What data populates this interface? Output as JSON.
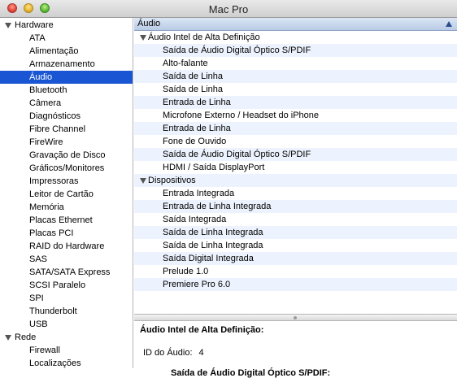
{
  "window": {
    "title": "Mac Pro"
  },
  "sidebar": {
    "rows": [
      {
        "type": "group",
        "label": "Hardware"
      },
      {
        "type": "item",
        "label": "ATA"
      },
      {
        "type": "item",
        "label": "Alimentação"
      },
      {
        "type": "item",
        "label": "Armazenamento"
      },
      {
        "type": "item",
        "label": "Áudio",
        "selected": true
      },
      {
        "type": "item",
        "label": "Bluetooth"
      },
      {
        "type": "item",
        "label": "Câmera"
      },
      {
        "type": "item",
        "label": "Diagnósticos"
      },
      {
        "type": "item",
        "label": "Fibre Channel"
      },
      {
        "type": "item",
        "label": "FireWire"
      },
      {
        "type": "item",
        "label": "Gravação de Disco"
      },
      {
        "type": "item",
        "label": "Gráficos/Monitores"
      },
      {
        "type": "item",
        "label": "Impressoras"
      },
      {
        "type": "item",
        "label": "Leitor de Cartão"
      },
      {
        "type": "item",
        "label": "Memória"
      },
      {
        "type": "item",
        "label": "Placas Ethernet"
      },
      {
        "type": "item",
        "label": "Placas PCI"
      },
      {
        "type": "item",
        "label": "RAID do Hardware"
      },
      {
        "type": "item",
        "label": "SAS"
      },
      {
        "type": "item",
        "label": "SATA/SATA Express"
      },
      {
        "type": "item",
        "label": "SCSI Paralelo"
      },
      {
        "type": "item",
        "label": "SPI"
      },
      {
        "type": "item",
        "label": "Thunderbolt"
      },
      {
        "type": "item",
        "label": "USB"
      },
      {
        "type": "group",
        "label": "Rede"
      },
      {
        "type": "item",
        "label": "Firewall"
      },
      {
        "type": "item",
        "label": "Localizações"
      }
    ]
  },
  "list": {
    "column_header": "Áudio",
    "rows": [
      {
        "type": "group",
        "label": "Áudio Intel de Alta Definição"
      },
      {
        "type": "item",
        "label": "Saída de Áudio Digital Óptico S/PDIF"
      },
      {
        "type": "item",
        "label": "Alto-falante"
      },
      {
        "type": "item",
        "label": "Saída de Linha"
      },
      {
        "type": "item",
        "label": "Saída de Linha"
      },
      {
        "type": "item",
        "label": "Entrada de Linha"
      },
      {
        "type": "item",
        "label": "Microfone Externo / Headset do iPhone"
      },
      {
        "type": "item",
        "label": "Entrada de Linha"
      },
      {
        "type": "item",
        "label": "Fone de Ouvido"
      },
      {
        "type": "item",
        "label": "Saída de Áudio Digital Óptico S/PDIF"
      },
      {
        "type": "item",
        "label": "HDMI / Saída DisplayPort"
      },
      {
        "type": "group",
        "label": "Dispositivos"
      },
      {
        "type": "item",
        "label": "Entrada Integrada"
      },
      {
        "type": "item",
        "label": "Entrada de Linha Integrada"
      },
      {
        "type": "item",
        "label": "Saída Integrada"
      },
      {
        "type": "item",
        "label": "Saída de Linha Integrada"
      },
      {
        "type": "item",
        "label": "Saída de Linha Integrada"
      },
      {
        "type": "item",
        "label": "Saída Digital Integrada"
      },
      {
        "type": "item",
        "label": "Prelude 1.0"
      },
      {
        "type": "item",
        "label": "Premiere Pro 6.0"
      }
    ]
  },
  "detail": {
    "heading": "Áudio Intel de Alta Definição:",
    "audio_id_label": "ID do Áudio:",
    "audio_id_value": "4",
    "subheading": "Saída de Áudio Digital Óptico S/PDIF:"
  },
  "colors": {
    "selection": "#1a56d4",
    "alt_row": "#edf3fe",
    "header": "#b9cbe6"
  }
}
